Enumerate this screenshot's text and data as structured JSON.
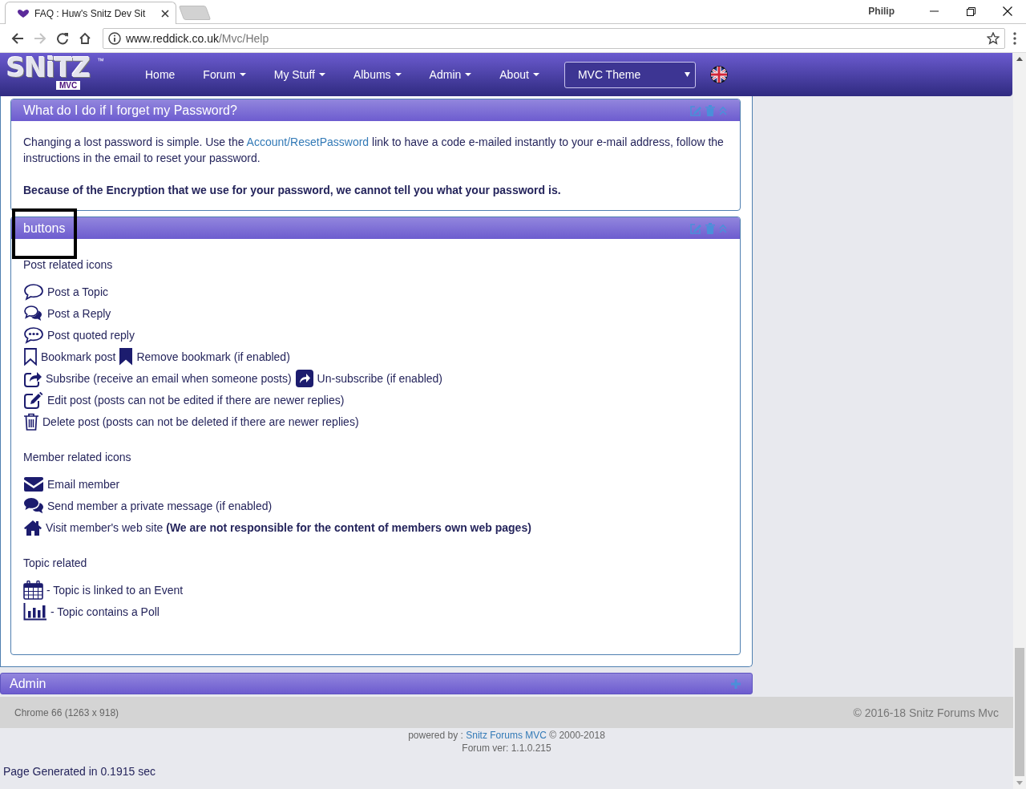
{
  "browser": {
    "tab_title": "FAQ : Huw's Snitz Dev Sit",
    "profile": "Philip",
    "url_host": "www.reddick.co.uk",
    "url_path": "/Mvc/Help",
    "forward_disabled": true
  },
  "navbar": {
    "logo": {
      "wordmark": "SNiTZ",
      "subtitle": "MVC",
      "trademark": "™"
    },
    "items": [
      {
        "label": "Home",
        "dropdown": false
      },
      {
        "label": "Forum",
        "dropdown": true
      },
      {
        "label": "My Stuff",
        "dropdown": true
      },
      {
        "label": "Albums",
        "dropdown": true
      },
      {
        "label": "Admin",
        "dropdown": true
      },
      {
        "label": "About",
        "dropdown": true
      }
    ],
    "theme_select": "MVC Theme"
  },
  "faq_panels": [
    {
      "title": "What do I do if I forget my Password?",
      "paragraph": {
        "before": "Changing a lost password is simple. Use the ",
        "link": "Account/ResetPassword",
        "after": " link to have a code e-mailed instantly to your e-mail address, follow the instructions in the email to reset your password."
      },
      "note": "Because of the Encryption that we use for your password, we cannot tell you what your password is."
    },
    {
      "title": "buttons",
      "sections": [
        {
          "heading": "Post related icons",
          "items": [
            {
              "segments": [
                {
                  "kind": "comment",
                  "text": "Post a Topic"
                }
              ]
            },
            {
              "segments": [
                {
                  "kind": "comments",
                  "text": "Post a Reply"
                }
              ]
            },
            {
              "segments": [
                {
                  "kind": "commenting",
                  "text": "Post quoted reply"
                }
              ]
            },
            {
              "segments": [
                {
                  "kind": "bookmark-outline",
                  "text": "Bookmark post"
                },
                {
                  "kind": "bookmark",
                  "text": "Remove bookmark (if enabled)"
                }
              ]
            },
            {
              "segments": [
                {
                  "kind": "share-outline",
                  "text": "Subsribe (receive an email when someone posts)"
                },
                {
                  "kind": "share-solid",
                  "text": "Un-subscribe (if enabled)"
                }
              ]
            },
            {
              "segments": [
                {
                  "kind": "edit",
                  "text": "Edit post (posts can not be edited if there are newer replies)"
                }
              ]
            },
            {
              "segments": [
                {
                  "kind": "trash",
                  "text": "Delete post (posts can not be deleted if there are newer replies)"
                }
              ]
            }
          ]
        },
        {
          "heading": "Member related icons",
          "items": [
            {
              "segments": [
                {
                  "kind": "envelope",
                  "text": "Email member"
                }
              ]
            },
            {
              "segments": [
                {
                  "kind": "chat",
                  "text": "Send member a private message (if enabled)"
                }
              ]
            },
            {
              "segments": [
                {
                  "kind": "home",
                  "text": "Visit member's web site **(We are not responsible for the content of members own web pages)**"
                }
              ]
            }
          ]
        },
        {
          "heading": "Topic related",
          "items": [
            {
              "segments": [
                {
                  "kind": "calendar",
                  "text": "- Topic is linked to an Event"
                }
              ]
            },
            {
              "segments": [
                {
                  "kind": "bar-chart",
                  "text": "- Topic contains a Poll"
                }
              ]
            }
          ]
        }
      ]
    }
  ],
  "admin_panel": {
    "title": "Admin",
    "expanded": false
  },
  "footer": {
    "browser_info": "Chrome 66 (1263 x 918)",
    "copyright": "© 2016-18 Snitz Forums Mvc",
    "powered_prefix": "powered by : ",
    "powered_link": "Snitz Forums MVC",
    "powered_suffix": " © 2000-2018",
    "version": "Forum ver: 1.1.0.215",
    "generated": "Page Generated in 0.1915 sec"
  }
}
